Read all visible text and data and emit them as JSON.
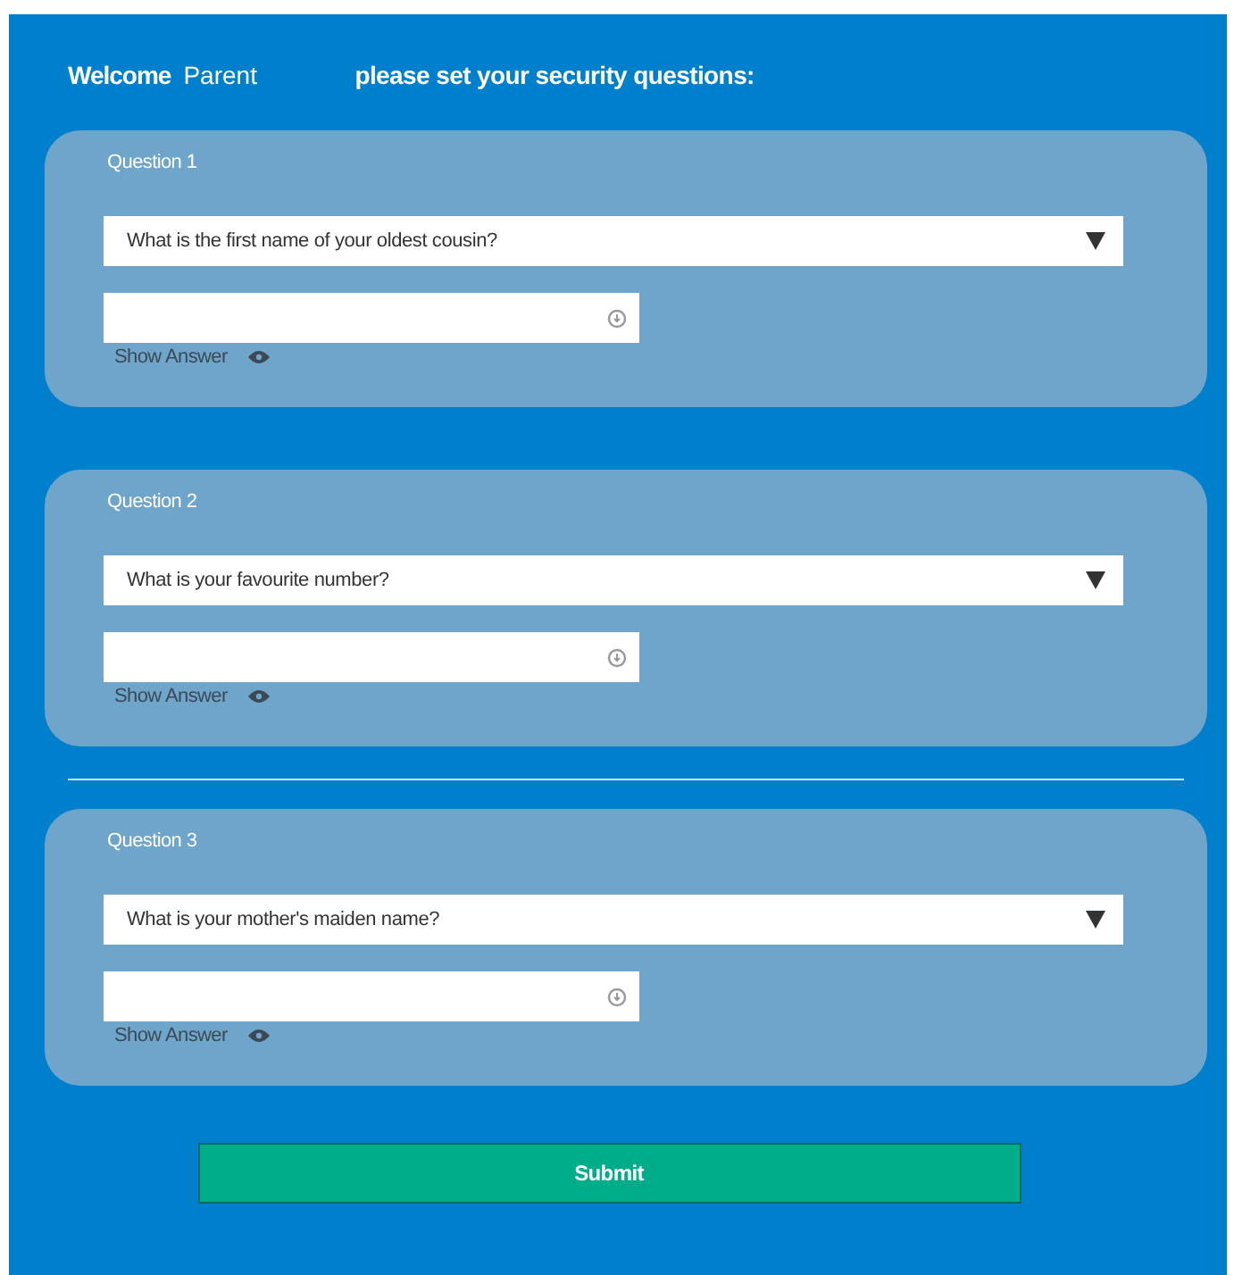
{
  "header": {
    "welcome": "Welcome",
    "user": "Parent",
    "prompt": "please set your security questions:"
  },
  "sections": [
    {
      "kind": "question",
      "label": "Question 1",
      "question": "What is the first name of your oldest cousin?",
      "show_answer": "Show Answer"
    },
    {
      "kind": "question",
      "label": "Question 2",
      "question": "What is your favourite number?",
      "show_answer": "Show Answer"
    },
    {
      "kind": "divider"
    },
    {
      "kind": "question",
      "label": "Question 3",
      "question": "What is your mother's maiden name?",
      "show_answer": "Show Answer"
    }
  ],
  "submit": "Submit"
}
